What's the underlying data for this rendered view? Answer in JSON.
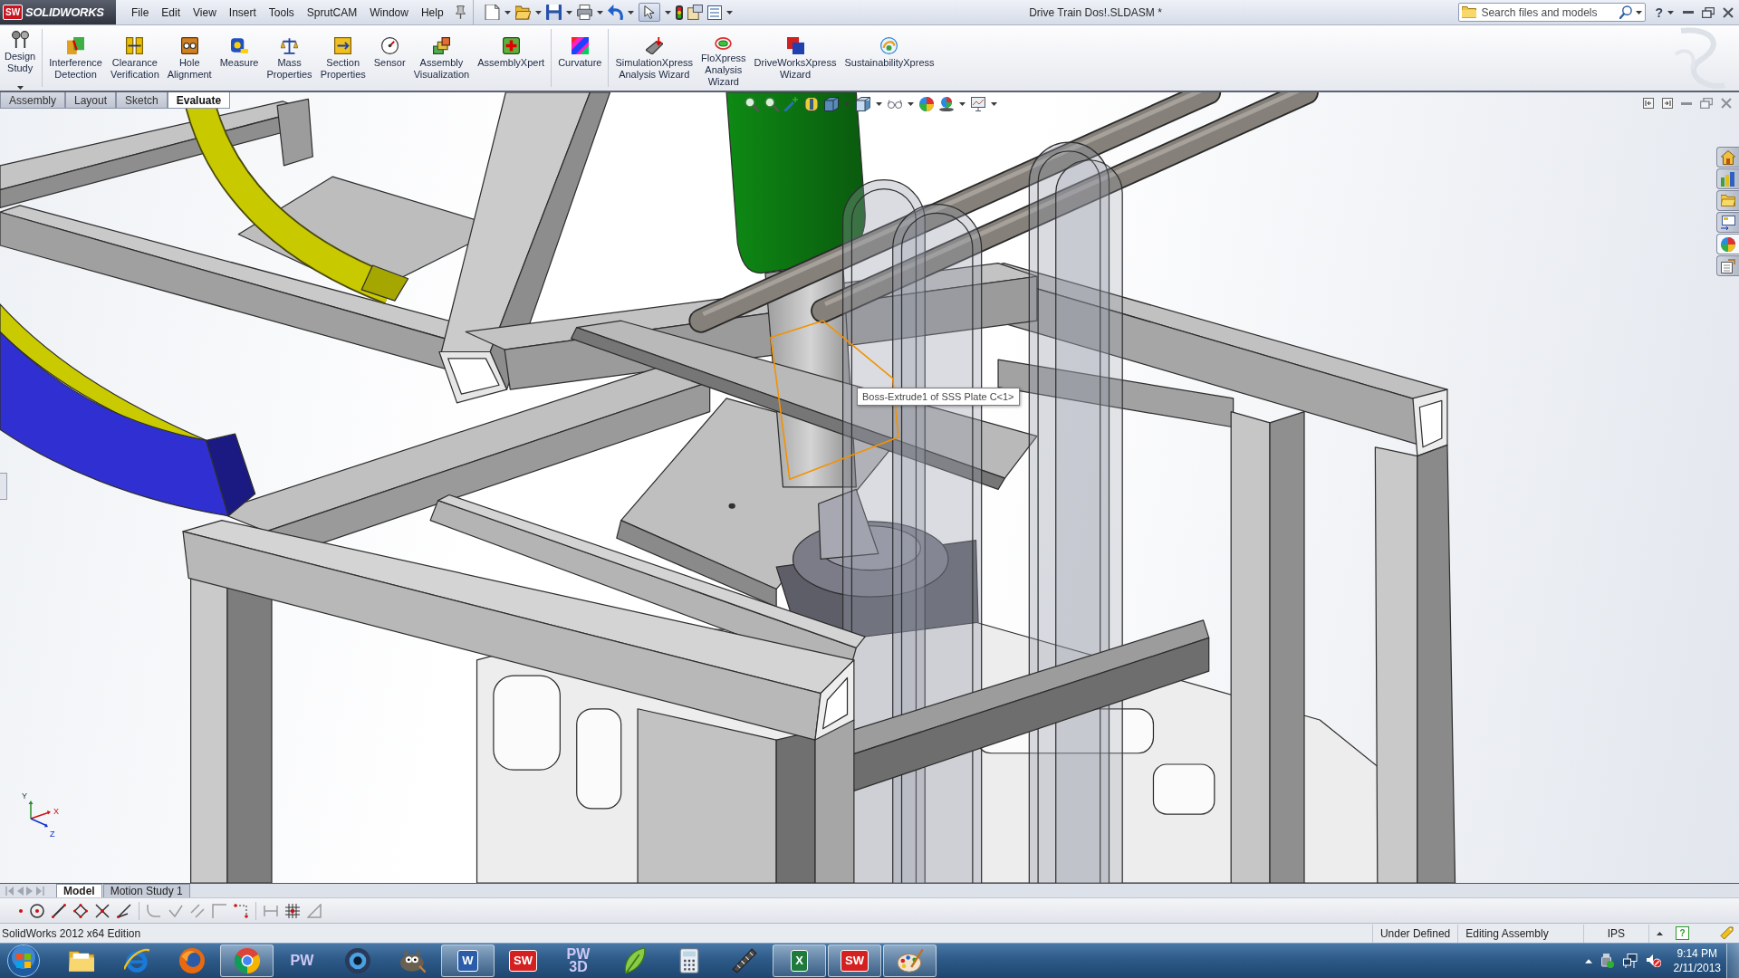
{
  "window": {
    "logo_badge": "SW",
    "logo_text": "SOLIDWORKS",
    "title": "Drive Train Dos!.SLDASM *",
    "help_label": "?"
  },
  "menu": [
    "File",
    "Edit",
    "View",
    "Insert",
    "Tools",
    "SprutCAM",
    "Window",
    "Help"
  ],
  "search": {
    "placeholder": "Search files and models"
  },
  "command_manager": {
    "groups": [
      {
        "buttons": [
          {
            "label": "Design Study",
            "kind": "design-study",
            "dropdown": true
          }
        ]
      },
      {
        "buttons": [
          {
            "label": "Interference Detection",
            "kind": "interference-detection",
            "dropdown": false
          },
          {
            "label": "Clearance Verification",
            "kind": "clearance-verification",
            "dropdown": false
          },
          {
            "label": "Hole Alignment",
            "kind": "hole-alignment",
            "dropdown": false
          },
          {
            "label": "Measure",
            "kind": "measure",
            "dropdown": false
          },
          {
            "label": "Mass Properties",
            "kind": "mass-properties",
            "dropdown": false
          },
          {
            "label": "Section Properties",
            "kind": "section-properties",
            "dropdown": false
          },
          {
            "label": "Sensor",
            "kind": "sensor",
            "dropdown": false
          },
          {
            "label": "Assembly Visualization",
            "kind": "assembly-visualization",
            "dropdown": false
          },
          {
            "label": "AssemblyXpert",
            "kind": "assemblyxpert",
            "dropdown": false
          }
        ]
      },
      {
        "buttons": [
          {
            "label": "Curvature",
            "kind": "curvature",
            "dropdown": false
          }
        ]
      },
      {
        "buttons": [
          {
            "label": "SimulationXpress Analysis Wizard",
            "kind": "simulationxpress",
            "dropdown": false
          },
          {
            "label": "FloXpress Analysis Wizard",
            "kind": "floxpress",
            "dropdown": false
          },
          {
            "label": "DriveWorksXpress Wizard",
            "kind": "driveworksxpress",
            "dropdown": false
          },
          {
            "label": "SustainabilityXpress",
            "kind": "sustainabilityxpress",
            "dropdown": false
          }
        ]
      }
    ]
  },
  "command_tabs": [
    {
      "label": "Assembly",
      "selected": false
    },
    {
      "label": "Layout",
      "selected": false
    },
    {
      "label": "Sketch",
      "selected": false
    },
    {
      "label": "Evaluate",
      "selected": true
    }
  ],
  "graphics_area": {
    "tooltip": "Boss-Extrude1 of SSS Plate C<1>",
    "triad_labels": [
      "Y",
      "X",
      "Z"
    ]
  },
  "task_pane_tabs": [
    {
      "kind": "home",
      "selected": false
    },
    {
      "kind": "design-library",
      "selected": false
    },
    {
      "kind": "file-explorer",
      "selected": false
    },
    {
      "kind": "view-palette",
      "selected": false
    },
    {
      "kind": "appearances",
      "selected": true
    },
    {
      "kind": "custom-properties",
      "selected": false
    }
  ],
  "model_tabs": [
    {
      "label": "Model",
      "selected": true
    },
    {
      "label": "Motion Study 1",
      "selected": false
    }
  ],
  "status_bar": {
    "edition": "SolidWorks 2012 x64 Edition",
    "fields": [
      "Under Defined",
      "Editing Assembly",
      "IPS"
    ],
    "help_label": "?"
  },
  "taskbar": {
    "apps": [
      {
        "kind": "explorer",
        "running": false
      },
      {
        "kind": "ie",
        "running": false
      },
      {
        "kind": "firefox",
        "running": false
      },
      {
        "kind": "chrome",
        "running": true
      },
      {
        "kind": "text-logo",
        "text": "PW",
        "color": "#cfc8f4",
        "running": false
      },
      {
        "kind": "lens",
        "running": false
      },
      {
        "kind": "gimp",
        "running": false
      },
      {
        "kind": "tile",
        "text": "W",
        "color": "#2a5caa",
        "running": true
      },
      {
        "kind": "tile",
        "text": "SW",
        "color": "#d42020",
        "running": false
      },
      {
        "kind": "text-logo",
        "text": "PW 3D",
        "color": "#cfc8f4",
        "running": false
      },
      {
        "kind": "pen",
        "running": false
      },
      {
        "kind": "calculator",
        "running": false
      },
      {
        "kind": "saw",
        "running": false
      },
      {
        "kind": "tile",
        "text": "X",
        "color": "#1e7b3c",
        "running": true
      },
      {
        "kind": "tile",
        "text": "SW",
        "color": "#d42020",
        "running": true
      },
      {
        "kind": "paint",
        "running": true
      }
    ],
    "clock": {
      "time": "9:14 PM",
      "date": "2/11/2013"
    }
  }
}
